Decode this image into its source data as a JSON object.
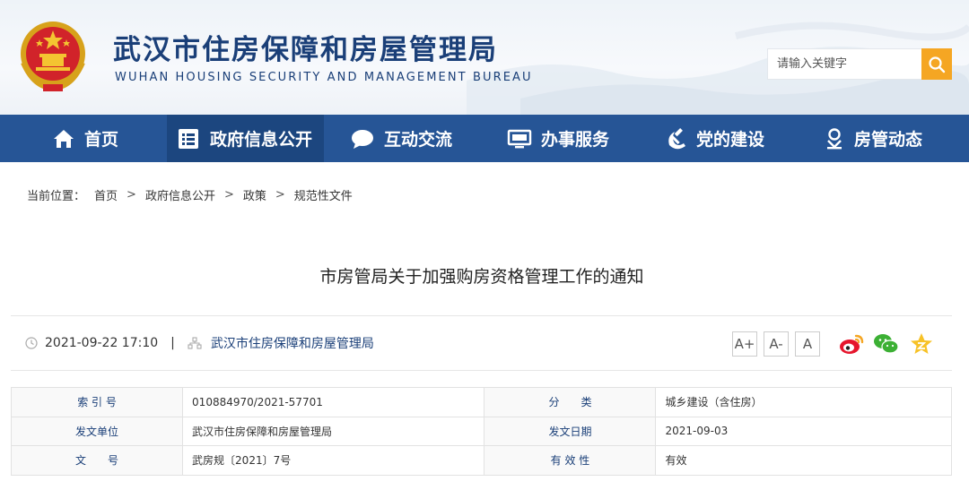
{
  "header": {
    "title": "武汉市住房保障和房屋管理局",
    "subtitle": "WUHAN HOUSING SECURITY AND MANAGEMENT BUREAU",
    "search_placeholder": "请输入关键字"
  },
  "nav": {
    "items": [
      {
        "label": "首页",
        "icon": "home-icon"
      },
      {
        "label": "政府信息公开",
        "icon": "document-list-icon",
        "active": true
      },
      {
        "label": "互动交流",
        "icon": "chat-bubble-icon"
      },
      {
        "label": "办事服务",
        "icon": "monitor-icon"
      },
      {
        "label": "党的建设",
        "icon": "hammer-sickle-icon"
      },
      {
        "label": "房管动态",
        "icon": "person-location-icon"
      }
    ]
  },
  "breadcrumb": {
    "prefix": "当前位置：",
    "items": [
      "首页",
      "政府信息公开",
      "政策",
      "规范性文件"
    ],
    "separator": ">"
  },
  "article": {
    "title": "市房管局关于加强购房资格管理工作的通知",
    "datetime": "2021-09-22 17:10",
    "divider": "|",
    "publisher": "武汉市住房保障和房屋管理局",
    "font_buttons": [
      "A+",
      "A-",
      "A"
    ],
    "share_icons": [
      "weibo-icon",
      "wechat-icon",
      "qzone-star-icon"
    ]
  },
  "info_table": {
    "rows": [
      {
        "label1": "索 引 号",
        "value1": "010884970/2021-57701",
        "label2": "分　　类",
        "value2": "城乡建设（含住房）"
      },
      {
        "label1": "发文单位",
        "value1": "武汉市住房保障和房屋管理局",
        "label2": "发文日期",
        "value2": "2021-09-03"
      },
      {
        "label1": "文　　号",
        "value1": "武房规〔2021〕7号",
        "label2": "有 效 性",
        "value2": "有效"
      }
    ]
  },
  "colors": {
    "nav_bg": "#265596",
    "nav_active": "#1c467f",
    "title_blue": "#1a3f78",
    "search_button": "#f5a623"
  }
}
